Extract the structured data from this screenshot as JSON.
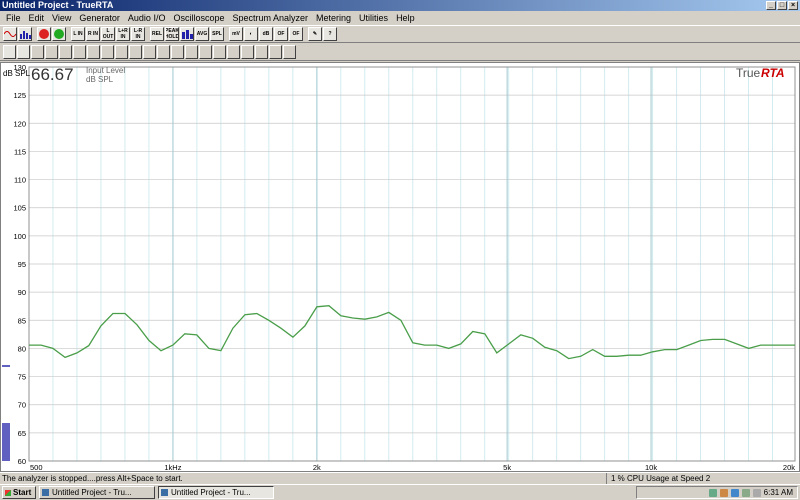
{
  "window": {
    "title": "Untitled Project - TrueRTA"
  },
  "menu": [
    "File",
    "Edit",
    "View",
    "Generator",
    "Audio I/O",
    "Oscilloscope",
    "Spectrum Analyzer",
    "Metering",
    "Utilities",
    "Help"
  ],
  "toolbar": {
    "buttons": [
      "",
      "",
      "STOP",
      "GO",
      "L IN",
      "R IN",
      "L OUT",
      "L+R IN",
      "L-R IN",
      "REL",
      "PEAK HOLD",
      "",
      "AVG",
      "SPL",
      "mV",
      "",
      "dB",
      "OF",
      "OF",
      "",
      ""
    ]
  },
  "plot": {
    "readout_value": "66.67",
    "readout_label1": "Input Level",
    "readout_label2": "dB SPL",
    "yunit": "dB SPL",
    "brand_prefix": "True",
    "brand_suffix": "RTA",
    "brand_color": "#cc0000",
    "trace_color": "#4a9e4a",
    "grid_color": "#bfe3e8",
    "level_bar_color": "#6060c0"
  },
  "status": {
    "left": "The analyzer is stopped....press Alt+Space to start.",
    "right": "1 % CPU Usage at Speed 2"
  },
  "taskbar": {
    "start_label": "Start",
    "tasks": [
      "Untitled Project - Tru...",
      "Untitled Project - Tru..."
    ],
    "clock": "6:31 AM"
  },
  "chart_data": {
    "type": "line",
    "xscale": "log",
    "xlim": [
      500,
      20000
    ],
    "ylim": [
      60,
      130
    ],
    "xticks": [
      {
        "value": 500,
        "label": "500"
      },
      {
        "value": 1000,
        "label": "1kHz"
      },
      {
        "value": 2000,
        "label": "2k"
      },
      {
        "value": 5000,
        "label": "5k"
      },
      {
        "value": 10000,
        "label": "10k"
      },
      {
        "value": 20000,
        "label": "20k"
      }
    ],
    "yticks": [
      60,
      65,
      70,
      75,
      80,
      85,
      90,
      95,
      100,
      105,
      110,
      115,
      120,
      125,
      130
    ],
    "series": [
      {
        "x": [
          500,
          530,
          561,
          595,
          630,
          667,
          707,
          749,
          794,
          841,
          891,
          944,
          1000,
          1059,
          1122,
          1189,
          1260,
          1335,
          1414,
          1498,
          1587,
          1682,
          1782,
          1888,
          2000,
          2119,
          2245,
          2378,
          2520,
          2670,
          2828,
          2997,
          3175,
          3364,
          3564,
          3775,
          4000,
          4238,
          4490,
          4757,
          5040,
          5339,
          5657,
          5993,
          6350,
          6727,
          7127,
          7551,
          8000,
          8476,
          8980,
          9514,
          10079,
          10679,
          11314,
          11986,
          12699,
          13454,
          14254,
          15102,
          16000,
          16951,
          17959,
          19027,
          20000
        ],
        "y": [
          80.6,
          80.6,
          80.0,
          78.4,
          79.2,
          80.5,
          84.0,
          86.2,
          86.2,
          84.2,
          81.4,
          79.6,
          80.6,
          82.6,
          82.4,
          80.0,
          79.6,
          83.6,
          86.0,
          86.2,
          85.0,
          83.6,
          82.0,
          84.0,
          87.4,
          87.6,
          85.8,
          85.4,
          85.2,
          85.6,
          86.4,
          85.0,
          81.0,
          80.6,
          80.6,
          80.0,
          80.8,
          83.0,
          82.6,
          79.2,
          80.8,
          82.4,
          81.8,
          80.2,
          79.6,
          78.2,
          78.6,
          79.8,
          78.6,
          78.6,
          78.8,
          78.8,
          79.4,
          79.8,
          79.8,
          80.6,
          81.4,
          81.6,
          81.6,
          80.8,
          80.0,
          80.6,
          80.6,
          80.6,
          80.6
        ]
      }
    ]
  }
}
